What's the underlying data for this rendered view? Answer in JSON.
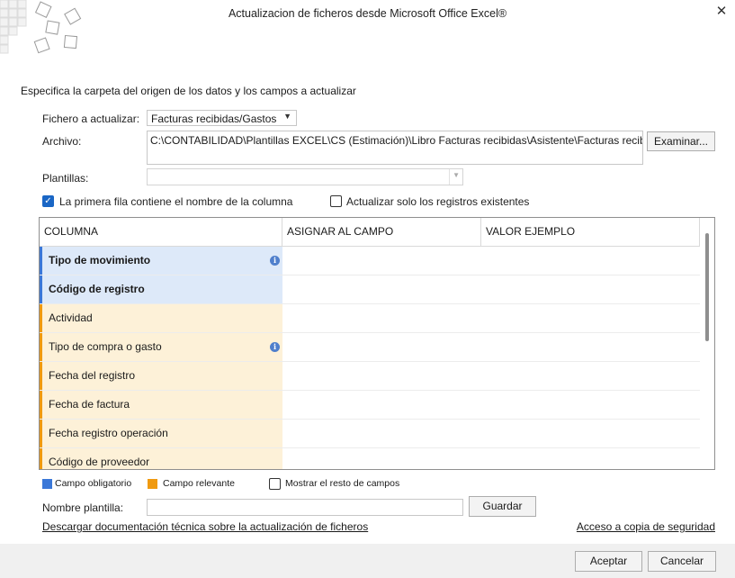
{
  "window": {
    "title": "Actualizacion de ficheros desde Microsoft Office Excel®"
  },
  "instructions": "Especifica la carpeta del origen de los datos y los campos a actualizar",
  "fichero": {
    "label": "Fichero a actualizar:",
    "value": "Facturas recibidas/Gastos"
  },
  "archivo": {
    "label": "Archivo:",
    "value": "C:\\CONTABILIDAD\\Plantillas EXCEL\\CS (Estimación)\\Libro Facturas recibidas\\Asistente\\Facturas recibidas asis",
    "button": "Examinar..."
  },
  "plantillas": {
    "label": "Plantillas:",
    "value": ""
  },
  "options": {
    "first_row": {
      "label": "La primera fila contiene el nombre de la columna",
      "checked": true
    },
    "only_existing": {
      "label": "Actualizar solo los registros existentes",
      "checked": false
    }
  },
  "grid": {
    "headers": [
      "COLUMNA",
      "ASIGNAR AL CAMPO",
      "VALOR EJEMPLO"
    ],
    "rows": [
      {
        "label": "Tipo de movimiento",
        "kind": "required",
        "info": true
      },
      {
        "label": "Código de registro",
        "kind": "required",
        "info": false
      },
      {
        "label": "Actividad",
        "kind": "relevant",
        "info": false
      },
      {
        "label": "Tipo de compra o gasto",
        "kind": "relevant",
        "info": true
      },
      {
        "label": "Fecha del registro",
        "kind": "relevant",
        "info": false
      },
      {
        "label": "Fecha de factura",
        "kind": "relevant",
        "info": false
      },
      {
        "label": "Fecha registro operación",
        "kind": "relevant",
        "info": false
      },
      {
        "label": "Código de proveedor",
        "kind": "relevant",
        "info": false
      }
    ]
  },
  "legend": {
    "required": {
      "label": "Campo obligatorio",
      "color": "#3b78d8"
    },
    "relevant": {
      "label": "Campo relevante",
      "color": "#f09a10"
    },
    "show_rest": {
      "label": "Mostrar el resto de campos",
      "checked": false
    }
  },
  "nombre_plantilla": {
    "label": "Nombre plantilla:",
    "value": "",
    "button": "Guardar"
  },
  "links": {
    "doc": "Descargar documentación técnica sobre la actualización de ficheros",
    "backup": "Acceso a copia de seguridad"
  },
  "footer": {
    "accept": "Aceptar",
    "cancel": "Cancelar"
  }
}
